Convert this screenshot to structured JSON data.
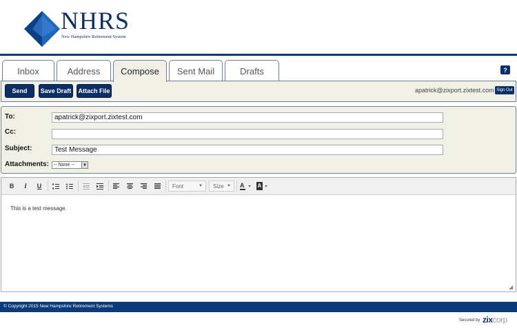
{
  "logo": {
    "name": "NHRS",
    "subtitle": "New Hampshire Retirement System"
  },
  "tabs": [
    {
      "label": "Inbox"
    },
    {
      "label": "Address"
    },
    {
      "label": "Compose"
    },
    {
      "label": "Sent Mail"
    },
    {
      "label": "Drafts"
    }
  ],
  "active_tab": "Compose",
  "help_label": "?",
  "actions": {
    "send": "Send",
    "save_draft": "Save Draft",
    "attach_file": "Attach File"
  },
  "user": {
    "email": "apatrick@zixport.zixtest.com",
    "sign_out": "Sign Out"
  },
  "form": {
    "to_label": "To:",
    "to_value": "apatrick@zixport.zixtest.com",
    "cc_label": "Cc:",
    "cc_value": "",
    "subject_label": "Subject:",
    "subject_value": "Test Message",
    "attachments_label": "Attachments:",
    "attachments_selected": "-- None --"
  },
  "toolbar": {
    "bold": "B",
    "italic": "I",
    "underline": "U",
    "font_label": "Font",
    "size_label": "Size",
    "icons": [
      "bold-icon",
      "italic-icon",
      "underline-icon",
      "ordered-list-icon",
      "unordered-list-icon",
      "outdent-icon",
      "indent-icon",
      "align-left-icon",
      "align-center-icon",
      "align-right-icon",
      "justify-icon",
      "text-color-icon",
      "background-color-icon"
    ]
  },
  "message_body": "This is a test message.",
  "footer": {
    "copyright": "© Copyright 2015 New Hampshire Retirement Systems"
  },
  "branding": {
    "secured_by": "Secured by",
    "zix": "zix",
    "corp": "corp"
  },
  "colors": {
    "navy": "#0b2f66",
    "panel": "#f1f0e7",
    "border": "#6d7f95"
  }
}
